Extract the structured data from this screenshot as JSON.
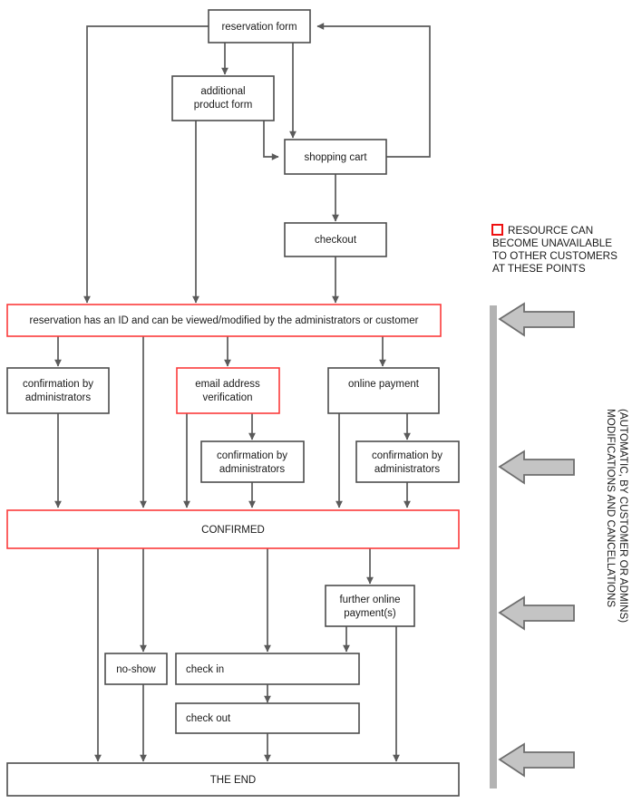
{
  "diagram": {
    "title": "reservation workflow flowchart",
    "colors": {
      "node_border": "#4d4d4d",
      "highlight_border": "#fb3b3b",
      "legend_swatch": "#ee1111",
      "edge": "#5a5a5a",
      "rail": "#b3b3b3",
      "arrow_fill": "#c4c4c4",
      "arrow_stroke": "#6e6e6e"
    },
    "nodes": {
      "reservation_form": "reservation form",
      "additional_product_form": "additional\nproduct form",
      "additional_product_form_line1": "additional",
      "additional_product_form_line2": "product form",
      "shopping_cart": "shopping cart",
      "checkout": "checkout",
      "reservation_id": "reservation has an ID and can be viewed/modified by the administrators or customer",
      "confirmation_admins_1": "confirmation by",
      "confirmation_admins_1b": "administrators",
      "email_verification_line1": "email address",
      "email_verification_line2": "verification",
      "online_payment": "online payment",
      "confirmation_admins_2": "confirmation by",
      "confirmation_admins_2b": "administrators",
      "confirmation_admins_3": "confirmation by",
      "confirmation_admins_3b": "administrators",
      "confirmed": "CONFIRMED",
      "further_payment_line1": "further online",
      "further_payment_line2": "payment(s)",
      "no_show": "no-show",
      "check_in": "check in",
      "check_out": "check out",
      "the_end": "THE END"
    },
    "legend": {
      "line1": "RESOURCE CAN",
      "line2": "BECOME UNAVAILABLE",
      "line3": "TO OTHER CUSTOMERS",
      "line4": "AT THESE POINTS"
    },
    "side_annotation": {
      "line1": "MODIFICATIONS AND CANCELLATIONS",
      "line2": "(AUTOMATIC, BY CUSTOMER OR ADMINS)"
    }
  }
}
